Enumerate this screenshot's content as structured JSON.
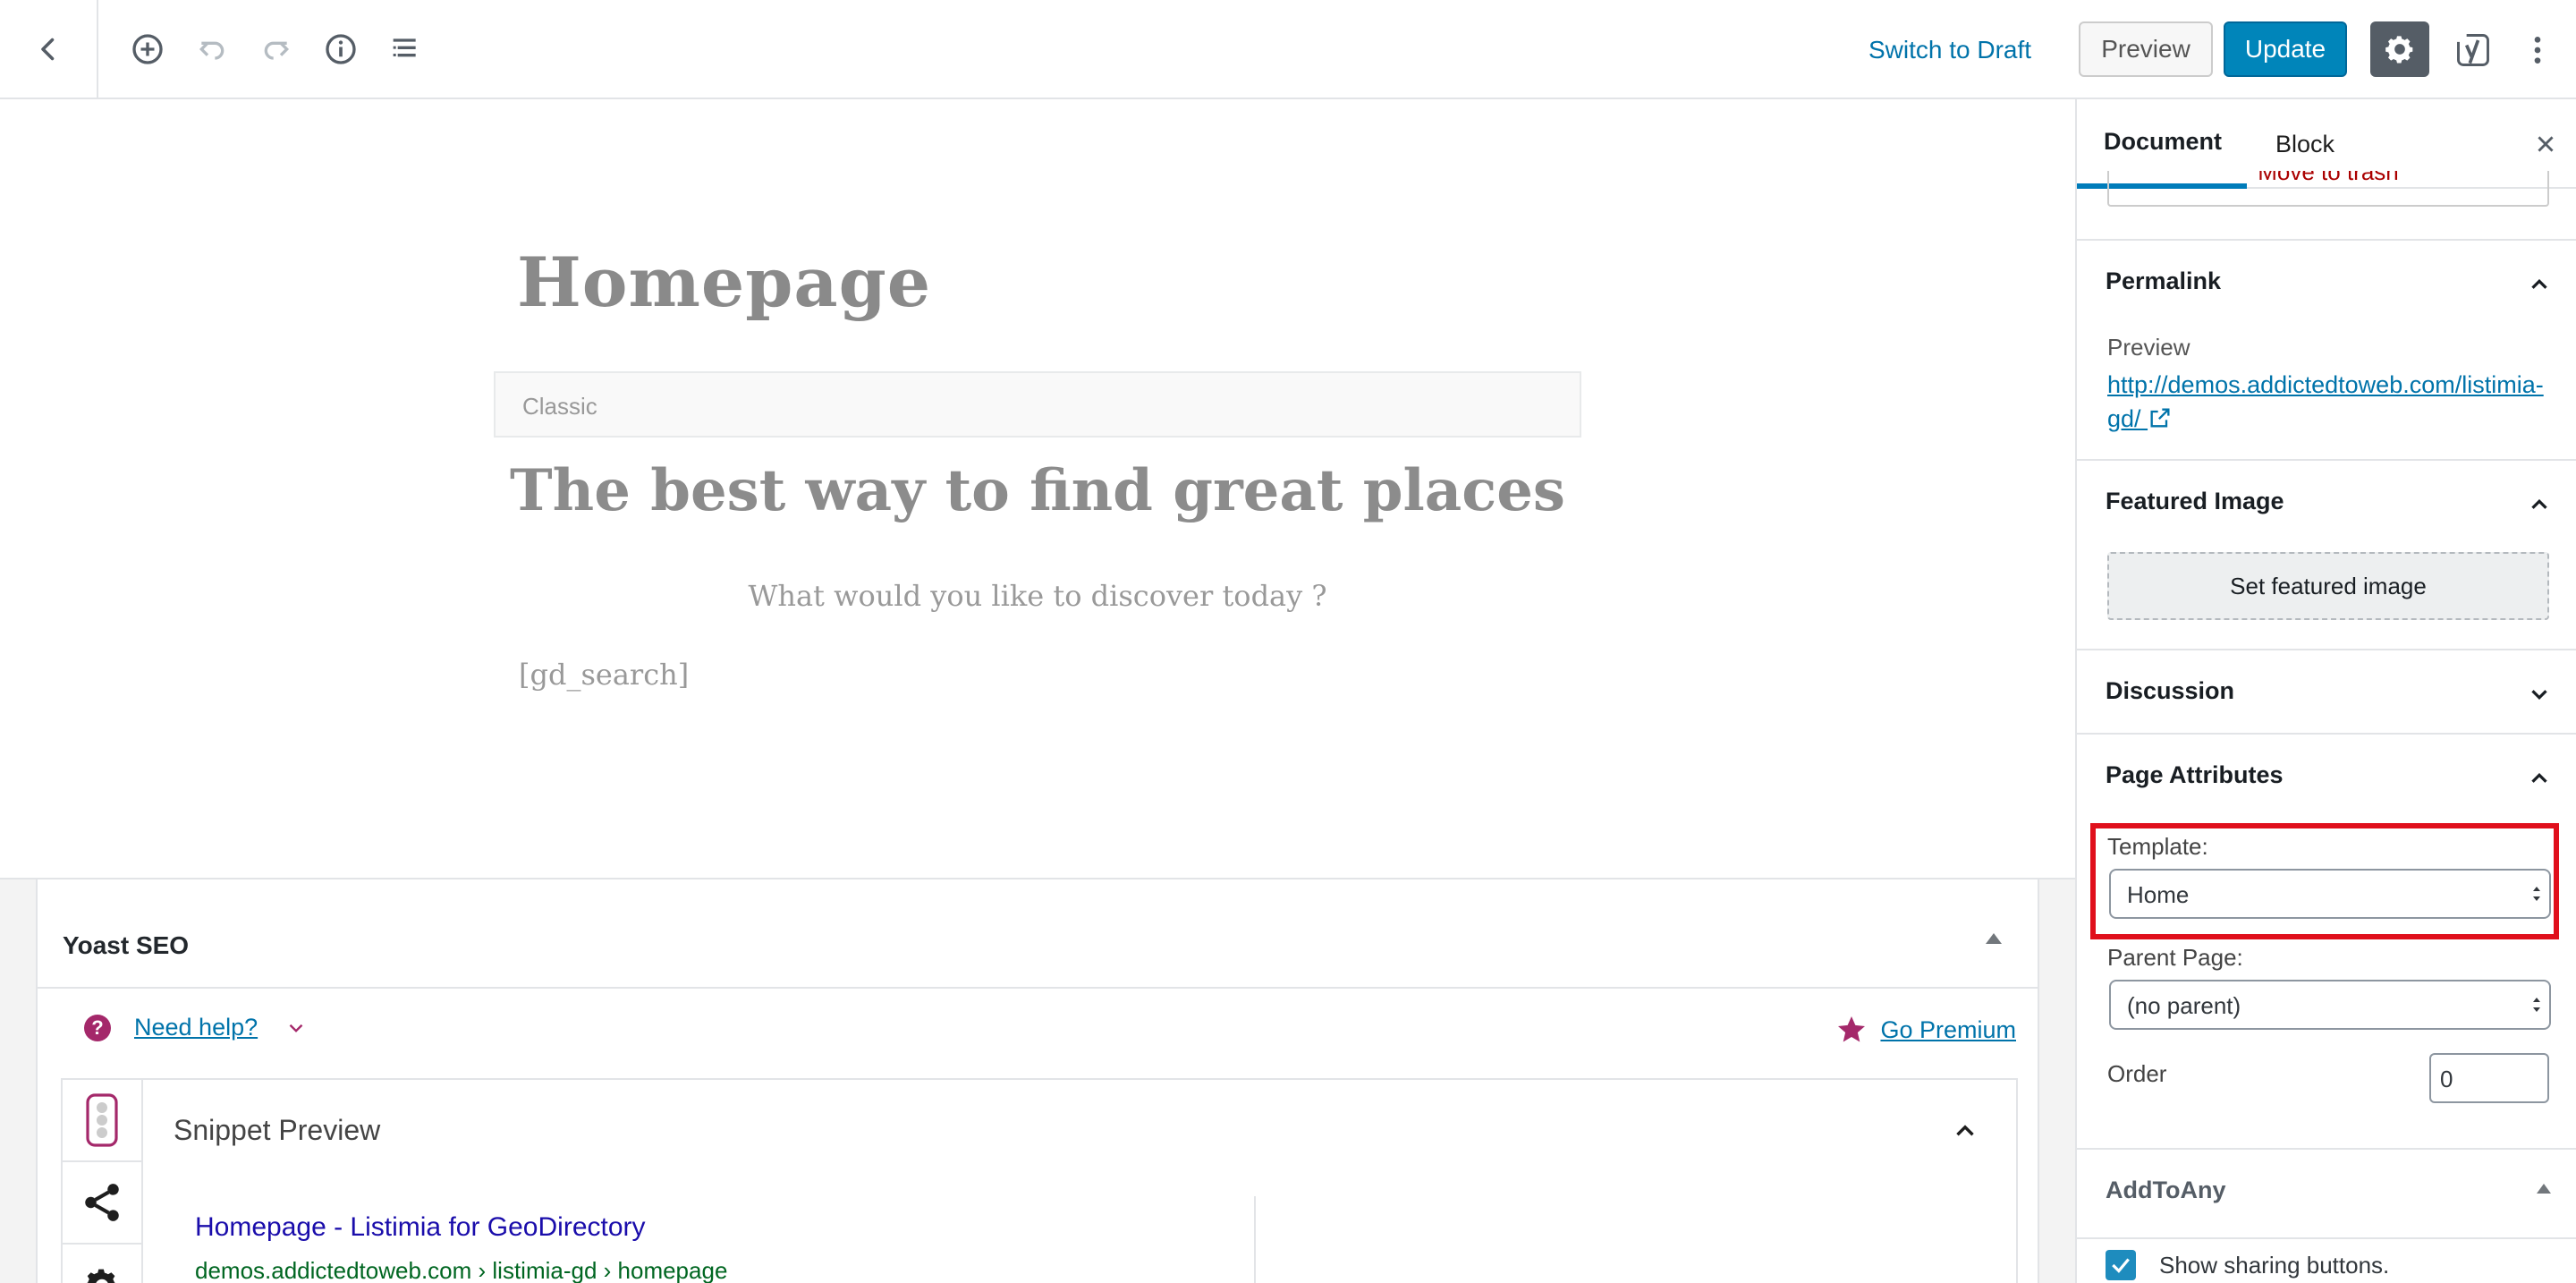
{
  "toolbar": {
    "switch_to_draft": "Switch to Draft",
    "preview": "Preview",
    "update": "Update"
  },
  "editor": {
    "post_title": "Homepage",
    "classic_label": "Classic",
    "heading": "The best way to find great places",
    "subheading": "What would you like to discover today ?",
    "shortcode": "[gd_search]"
  },
  "yoast": {
    "title": "Yoast SEO",
    "need_help": "Need help?",
    "go_premium": "Go Premium",
    "snippet_title": "Snippet Preview",
    "snippet_link": "Homepage - Listimia for GeoDirectory",
    "snippet_url": "demos.addictedtoweb.com › listimia-gd › homepage"
  },
  "sidebar": {
    "tab_document": "Document",
    "tab_block": "Block",
    "move_to_trash": "Move to trash",
    "permalink": {
      "title": "Permalink",
      "preview_label": "Preview",
      "url": "http://demos.addictedtoweb.com/listimia-gd/"
    },
    "featured_image": {
      "title": "Featured Image",
      "button": "Set featured image"
    },
    "discussion": {
      "title": "Discussion"
    },
    "page_attributes": {
      "title": "Page Attributes",
      "template_label": "Template:",
      "template_value": "Home",
      "parent_label": "Parent Page:",
      "parent_value": "(no parent)",
      "order_label": "Order",
      "order_value": "0"
    },
    "addtoany": {
      "title": "AddToAny",
      "show_sharing": "Show sharing buttons."
    }
  },
  "colors": {
    "accent": "#0085ba",
    "link": "#0073aa",
    "highlight": "#e0101c",
    "yoast": "#a4286a"
  }
}
